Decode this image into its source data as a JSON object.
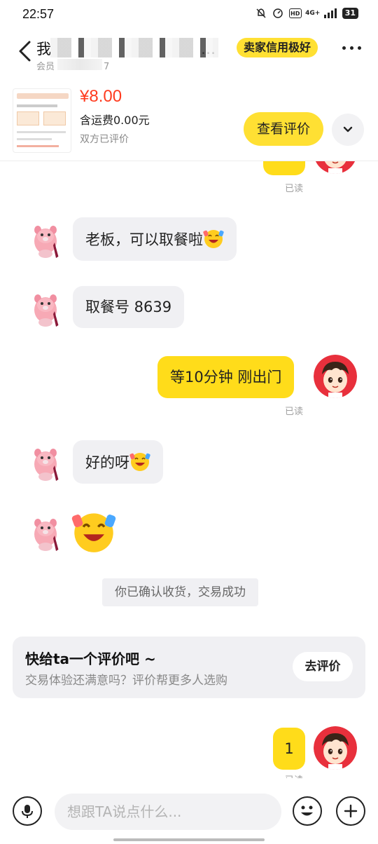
{
  "status_bar": {
    "time": "22:57",
    "network": "4G+",
    "hd": "HD",
    "battery": "31"
  },
  "header": {
    "title_prefix": "我",
    "title_suffix": "…",
    "subtitle_prefix": "会员",
    "subtitle_suffix": "7",
    "credit_badge": "卖家信用极好"
  },
  "product": {
    "price": "¥8.00",
    "shipping": "含运费0.00元",
    "rated_status": "双方已评价",
    "review_button": "查看评价"
  },
  "messages": {
    "top_partial_read": "已读",
    "m1_text": "老板，可以取餐啦",
    "m2_text": "取餐号 8639",
    "m3_text": "等10分钟 刚出门",
    "m3_read": "已读",
    "m4_text": "好的呀",
    "m6_text": "1",
    "m6_read": "已读"
  },
  "system_message": "你已确认收货，交易成功",
  "review_prompt": {
    "title": "快给ta一个评价吧 ~",
    "subtitle": "交易体验还满意吗？评价帮更多人选购",
    "button": "去评价"
  },
  "input": {
    "placeholder": "想跟TA说点什么..."
  },
  "colors": {
    "accent_yellow": "#ffdc1a",
    "price_red": "#ff3b1f",
    "bubble_gray": "#f0f0f3"
  },
  "icons": {
    "back": "chevron-left-icon",
    "more": "more-dots-icon",
    "expand": "chevron-down-icon",
    "mic": "microphone-icon",
    "emoji": "smiley-icon",
    "plus": "plus-icon"
  }
}
